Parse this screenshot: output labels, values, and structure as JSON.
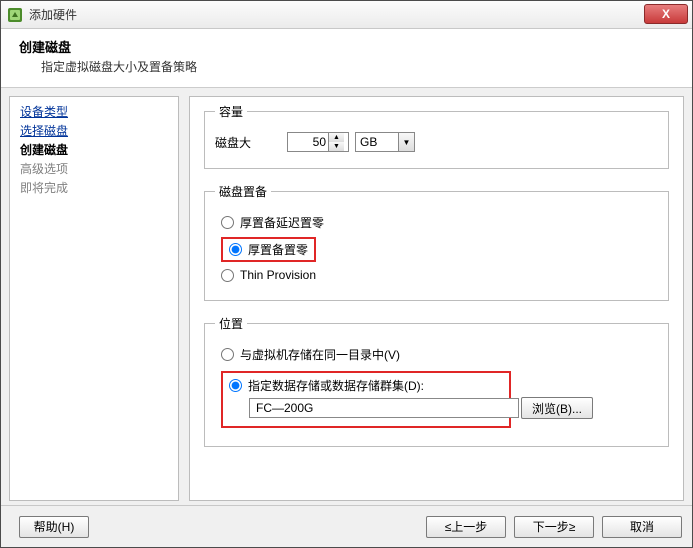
{
  "window": {
    "title": "添加硬件",
    "close_label": "X"
  },
  "header": {
    "title": "创建磁盘",
    "subtitle": "指定虚拟磁盘大小及置备策略"
  },
  "sidebar": {
    "items": [
      {
        "label": "设备类型",
        "state": "link"
      },
      {
        "label": "选择磁盘",
        "state": "link"
      },
      {
        "label": "创建磁盘",
        "state": "current"
      },
      {
        "label": "高级选项",
        "state": "future"
      },
      {
        "label": "即将完成",
        "state": "future"
      }
    ]
  },
  "capacity": {
    "legend": "容量",
    "size_label": "磁盘大",
    "size_value": "50",
    "unit_value": "GB"
  },
  "provision": {
    "legend": "磁盘置备",
    "options": [
      {
        "label": "厚置备延迟置零",
        "selected": false,
        "highlight": false
      },
      {
        "label": "厚置备置零",
        "selected": true,
        "highlight": true
      },
      {
        "label": "Thin Provision",
        "selected": false,
        "highlight": false
      }
    ]
  },
  "location": {
    "legend": "位置",
    "option_same": "与虚拟机存储在同一目录中(V)",
    "option_specify": "指定数据存储或数据存储群集(D):",
    "selected": "specify",
    "datastore_value": "FC—200G",
    "browse_label": "浏览(B)..."
  },
  "footer": {
    "help": "帮助(H)",
    "back": "≤上一步",
    "next": "下一步≥",
    "cancel": "取消"
  }
}
